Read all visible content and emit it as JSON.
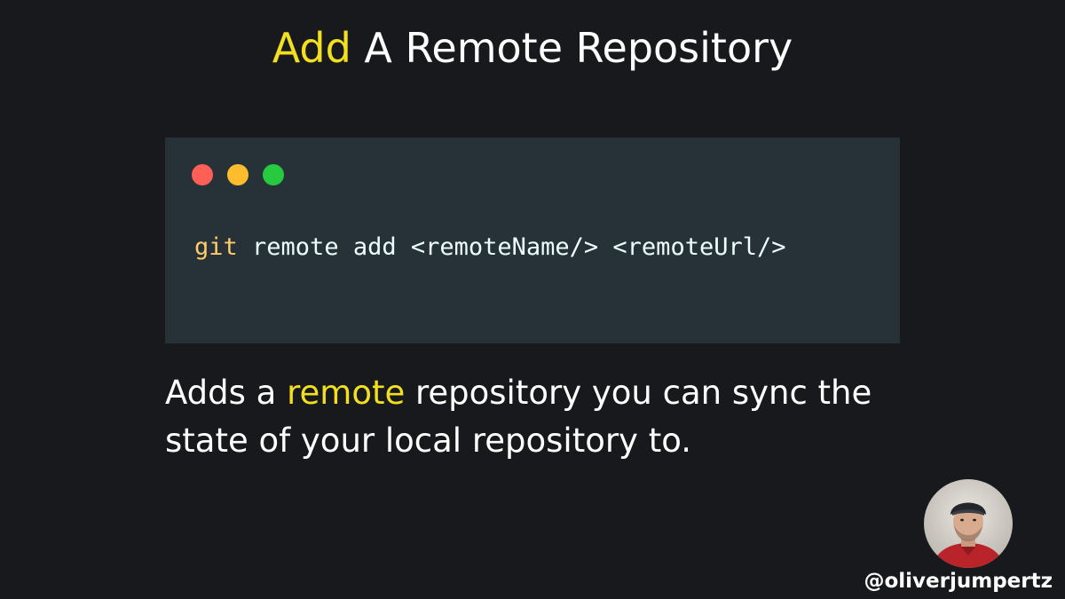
{
  "title": {
    "accent": "Add",
    "rest": " A Remote Repository"
  },
  "code_window": {
    "dots": [
      {
        "name": "close",
        "color": "#ff5f56"
      },
      {
        "name": "minimize",
        "color": "#ffbd2e"
      },
      {
        "name": "maximize",
        "color": "#27c93f"
      }
    ],
    "code": {
      "command": "git",
      "args": " remote add <remoteName/> <remoteUrl/>"
    }
  },
  "description": {
    "before": "Adds a ",
    "accent": "remote",
    "after": " repository you can sync the state of your local repository to."
  },
  "author": {
    "handle": "@oliverjumpertz"
  },
  "colors": {
    "background": "#18191d",
    "code_background": "#263238",
    "accent": "#f2e020",
    "code_keyword": "#ffcb6b"
  }
}
